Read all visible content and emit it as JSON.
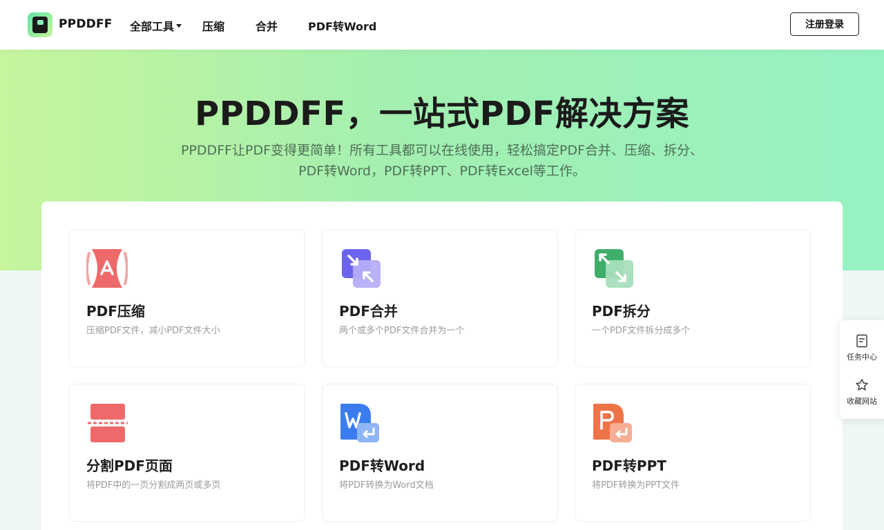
{
  "header": {
    "brand": "PPDDFF",
    "nav": {
      "all_tools": "全部工具",
      "compress": "压缩",
      "merge": "合并",
      "pdf_to_word": "PDF转Word"
    },
    "login": "注册登录"
  },
  "hero": {
    "title": "PPDDFF，一站式PDF解决方案",
    "subtitle_line1": "PPDDFF让PDF变得更简单！所有工具都可以在线使用，轻松搞定PDF合并、压缩、拆分、",
    "subtitle_line2": "PDF转Word，PDF转PPT、PDF转Excel等工作。"
  },
  "tools": [
    {
      "title": "PDF压缩",
      "desc": "压缩PDF文件，减小PDF文件大小",
      "icon": "compress-icon",
      "color": "#ee6a6a"
    },
    {
      "title": "PDF合并",
      "desc": "两个或多个PDF文件合并为一个",
      "icon": "merge-icon",
      "color": "#7b73f0"
    },
    {
      "title": "PDF拆分",
      "desc": "一个PDF文件拆分成多个",
      "icon": "split-icon",
      "color": "#3fb36d"
    },
    {
      "title": "分割PDF页面",
      "desc": "将PDF中的一页分割成两页或多页",
      "icon": "page-split-icon",
      "color": "#ee6a6a"
    },
    {
      "title": "PDF转Word",
      "desc": "将PDF转换为Word文档",
      "icon": "word-icon",
      "color": "#3b7ef0"
    },
    {
      "title": "PDF转PPT",
      "desc": "将PDF转换为PPT文件",
      "icon": "ppt-icon",
      "color": "#ee7a4a"
    }
  ],
  "side": {
    "task_center": "任务中心",
    "favorite": "收藏网站"
  }
}
